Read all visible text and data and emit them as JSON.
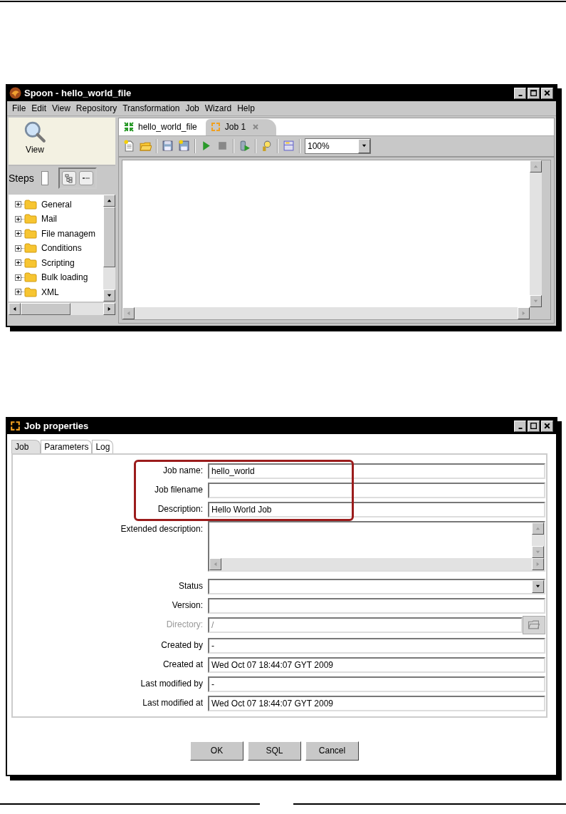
{
  "spoon_window": {
    "title": "Spoon - hello_world_file",
    "menu": [
      "File",
      "Edit",
      "View",
      "Repository",
      "Transformation",
      "Job",
      "Wizard",
      "Help"
    ],
    "view_button": "View",
    "steps_label": "Steps",
    "tree": [
      {
        "label": "General",
        "expanded": false
      },
      {
        "label": "Mail",
        "expanded": false
      },
      {
        "label": "File managem",
        "expanded": false
      },
      {
        "label": "Conditions",
        "expanded": false
      },
      {
        "label": "Scripting",
        "expanded": false
      },
      {
        "label": "Bulk loading",
        "expanded": false
      },
      {
        "label": "XML",
        "expanded": false
      }
    ],
    "tabs": [
      {
        "label": "hello_world_file",
        "kind": "transformation",
        "selected": false,
        "closable": false
      },
      {
        "label": "Job 1",
        "kind": "job",
        "selected": true,
        "closable": true
      }
    ],
    "zoom": "100%"
  },
  "job_dialog": {
    "title": "Job properties",
    "tabs": [
      {
        "label": "Job",
        "selected": true
      },
      {
        "label": "Parameters",
        "selected": false
      },
      {
        "label": "Log",
        "selected": false
      }
    ],
    "fields": [
      {
        "label": "Job name:",
        "kind": "text",
        "value": "hello_world",
        "highlighted": true,
        "disabled": false
      },
      {
        "label": "Job filename",
        "kind": "text",
        "highlighted": true,
        "disabled": false
      },
      {
        "label": "Description:",
        "kind": "text",
        "value": "Hello World Job",
        "highlighted": true,
        "disabled": false
      },
      {
        "label": "Extended description:",
        "kind": "textarea",
        "highlighted": false,
        "disabled": false
      },
      {
        "label": "Status",
        "kind": "combo",
        "highlighted": false,
        "disabled": false
      },
      {
        "label": "Version:",
        "kind": "text",
        "highlighted": false,
        "disabled": false
      },
      {
        "label": "Directory:",
        "kind": "browse",
        "value": "/",
        "highlighted": false,
        "disabled": true
      },
      {
        "label": "Created by",
        "kind": "text",
        "value": "-",
        "highlighted": false,
        "disabled": false
      },
      {
        "label": "Created at",
        "kind": "text",
        "value": "Wed Oct 07 18:44:07 GYT 2009",
        "highlighted": false,
        "disabled": false
      },
      {
        "label": "Last modified by",
        "kind": "text",
        "value": "-",
        "highlighted": false,
        "disabled": false
      },
      {
        "label": "Last modified at",
        "kind": "text",
        "value": "Wed Oct 07 18:44:07 GYT 2009",
        "highlighted": false,
        "disabled": false
      }
    ],
    "buttons": [
      "OK",
      "SQL",
      "Cancel"
    ]
  }
}
